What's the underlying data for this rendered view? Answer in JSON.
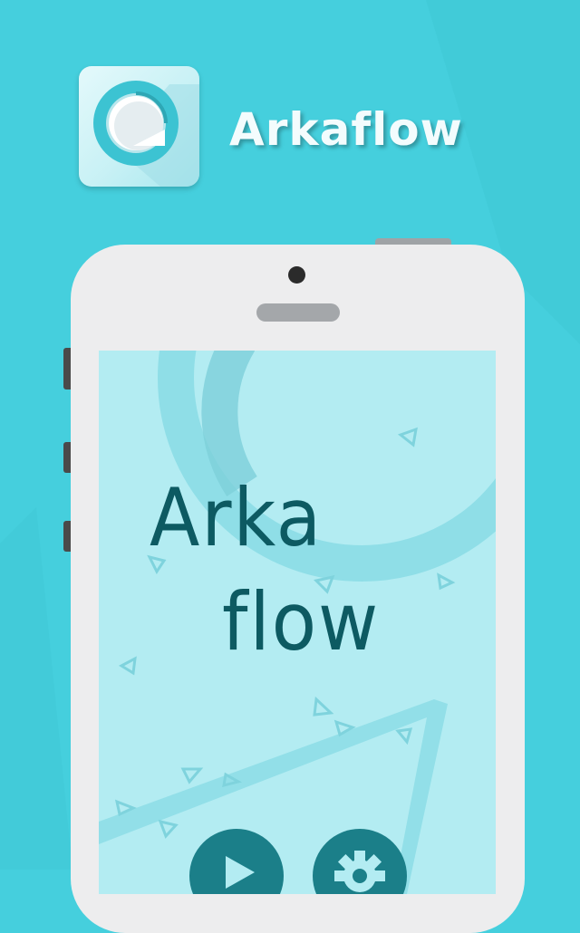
{
  "header": {
    "app_icon": "arkaflow-ring-icon",
    "app_name": "Arkaflow"
  },
  "phone": {
    "screen": {
      "logo_line_1": "Arka",
      "logo_line_2": "flow",
      "buttons": [
        {
          "name": "play-button",
          "icon": "play-icon"
        },
        {
          "name": "settings-button",
          "icon": "gear-icon"
        }
      ]
    }
  },
  "colors": {
    "background": "#45cfdd",
    "phone_body": "#ededee",
    "screen": "#b3ecf2",
    "logo_text": "#0d5a62",
    "button": "#1b7f89"
  }
}
